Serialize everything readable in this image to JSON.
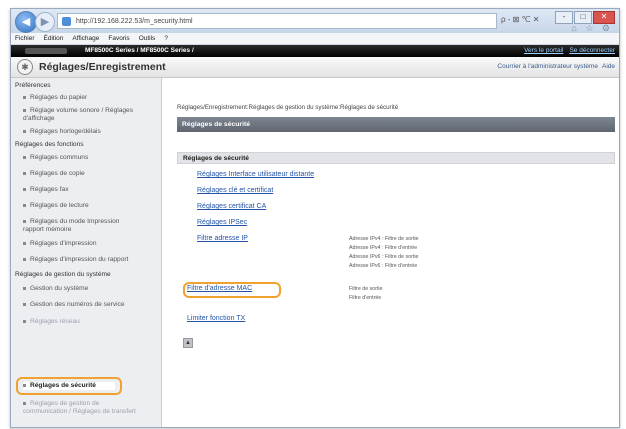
{
  "browser": {
    "address": "http://192.168.222.53/m_security.html",
    "address_tools": "ρ - ⊠ ℃ ✕",
    "window_buttons": [
      "-",
      "□",
      "✕"
    ],
    "tool_icons": "⌂ ☆ ⚙"
  },
  "menu": [
    "Fichier",
    "Édition",
    "Affichage",
    "Favoris",
    "Outils",
    "?"
  ],
  "banner": {
    "model": "MF8500C Series / MF8500C Series /",
    "portal_link": "Vers le portail",
    "logout_link": "Se déconnecter"
  },
  "header": {
    "title": "Réglages/Enregistrement",
    "mail_link": "Courrier à l'administrateur système",
    "help_link": "Aide"
  },
  "sidebar": {
    "preferences_head": "Préférences",
    "preferences": [
      "Réglages du papier",
      "Réglage volume sonore / Réglages d'affichage",
      "Réglages horloge/délais"
    ],
    "functions_head": "Réglages des fonctions",
    "functions": [
      "Réglages communs",
      "Réglages de copie",
      "Réglages fax",
      "Réglages de lecture",
      "Réglages du mode Impression rapport mémoire",
      "Réglages d'impression",
      "Réglages d'impression du rapport"
    ],
    "system_head": "Réglages de gestion du système",
    "system": [
      "Gestion du système",
      "Gestion des numéros de service",
      "Réglages réseau",
      "Réglages de sécurité",
      "Réglages de gestion de communication / Réglages de transfert"
    ]
  },
  "main": {
    "breadcrumb": "Réglages/Enregistrement:Réglages de gestion du système:Réglages de sécurité",
    "section_title": "Réglages de sécurité",
    "subsection_title": "Réglages de sécurité",
    "links": {
      "remote_ui": "Réglages Interface utilisateur distante",
      "key_cert": "Réglages clé et certificat",
      "ca_cert": "Réglages certificat CA",
      "ipsec": "Réglages IPSec",
      "ip_filter": "Filtre adresse IP",
      "mac_filter": "Filtre d'adresse MAC",
      "tx_limit": "Limiter fonction TX"
    },
    "ip_filter_info": [
      "Adresse IPv4 : Filtre de sortie",
      "Adresse IPv4 : Filtre d'entrée",
      "Adresse IPv6 : Filtre de sortie",
      "Adresse IPv6 : Filtre d'entrée"
    ],
    "mac_filter_info": [
      "Filtre de sortie",
      "Filtre d'entrée"
    ],
    "top_button": "▲"
  },
  "colors": {
    "highlight": "#f0a230",
    "section_bar": "#666d77",
    "link": "#2354a8"
  }
}
